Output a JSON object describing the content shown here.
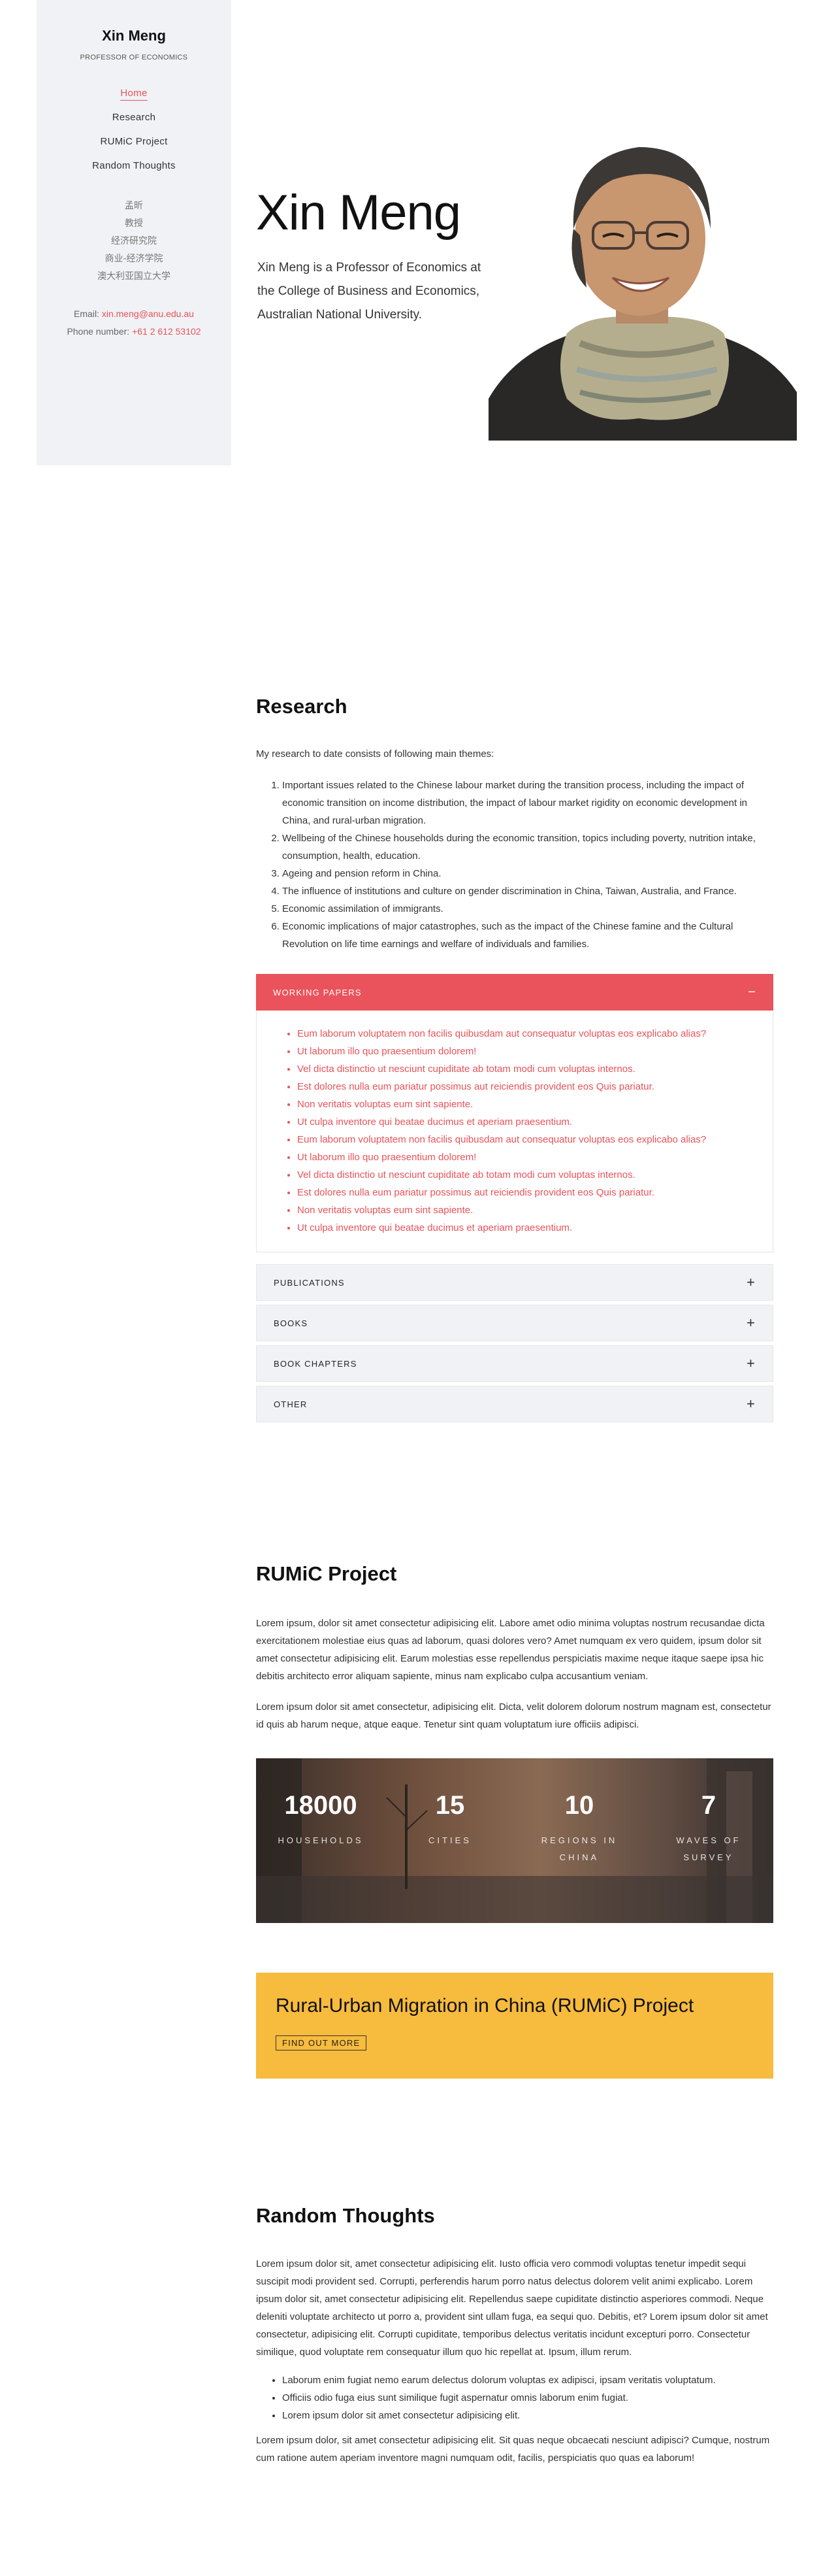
{
  "sidebar": {
    "name": "Xin Meng",
    "role": "PROFESSOR OF ECONOMICS",
    "nav": [
      "Home",
      "Research",
      "RUMiC Project",
      "Random Thoughts"
    ],
    "chinese": [
      "孟昕",
      "教授",
      "经济研究院",
      "商业-经济学院",
      "澳大利亚国立大学"
    ],
    "email_label": "Email: ",
    "email": "xin.meng@anu.edu.au",
    "phone_label": "Phone number: ",
    "phone": "+61 2 612 53102"
  },
  "hero": {
    "title": "Xin Meng",
    "subtitle": "Xin Meng is a Professor of Economics at the College of Business and Economics, Australian National University."
  },
  "research": {
    "heading": "Research",
    "intro": "My research to date consists of following main themes:",
    "themes": [
      "Important issues related to the Chinese labour market during the transition process, including the impact of economic transition on income distribution, the impact of labour market rigidity on economic development in China, and rural-urban migration.",
      "Wellbeing of the Chinese households during the economic transition, topics including poverty, nutrition intake, consumption, health, education.",
      "Ageing and pension reform in China.",
      "The influence of institutions and culture on gender discrimination in China, Taiwan, Australia, and France.",
      "Economic assimilation of immigrants.",
      "Economic implications of major catastrophes, such as the impact of the Chinese famine and the Cultural Revolution on life time earnings and welfare of individuals and families."
    ],
    "accordion": {
      "open_label": "WORKING PAPERS",
      "open_icon": "minus-icon",
      "papers": [
        "Eum laborum voluptatem non facilis quibusdam aut consequatur voluptas eos explicabo alias?",
        "Ut laborum illo quo praesentium dolorem!",
        "Vel dicta distinctio ut nesciunt cupiditate ab totam modi cum voluptas internos.",
        "Est dolores nulla eum pariatur possimus aut reiciendis provident eos Quis pariatur.",
        "Non veritatis voluptas eum sint sapiente.",
        "Ut culpa inventore qui beatae ducimus et aperiam praesentium.",
        "Eum laborum voluptatem non facilis quibusdam aut consequatur voluptas eos explicabo alias?",
        "Ut laborum illo quo praesentium dolorem!",
        "Vel dicta distinctio ut nesciunt cupiditate ab totam modi cum voluptas internos.",
        "Est dolores nulla eum pariatur possimus aut reiciendis provident eos Quis pariatur.",
        "Non veritatis voluptas eum sint sapiente.",
        "Ut culpa inventore qui beatae ducimus et aperiam praesentium."
      ],
      "closed": [
        "PUBLICATIONS",
        "BOOKS",
        "BOOK CHAPTERS",
        "OTHER"
      ],
      "closed_icon": "plus-icon"
    }
  },
  "rumic": {
    "heading": "RUMiC Project",
    "para1": "Lorem ipsum, dolor sit amet consectetur adipisicing elit. Labore amet odio minima voluptas nostrum recusandae dicta exercitationem molestiae eius quas ad laborum, quasi dolores vero? Amet numquam ex vero quidem, ipsum dolor sit amet consectetur adipisicing elit. Earum molestias esse repellendus perspiciatis maxime neque itaque saepe ipsa hic debitis architecto error aliquam sapiente, minus nam explicabo culpa accusantium veniam.",
    "para2": "Lorem ipsum dolor sit amet consectetur, adipisicing elit. Dicta, velit dolorem dolorum nostrum magnam est, consectetur id quis ab harum neque, atque eaque. Tenetur sint quam voluptatum iure officiis adipisci.",
    "stats": [
      {
        "num": "18000",
        "label": "HOUSEHOLDS"
      },
      {
        "num": "15",
        "label": "CITIES"
      },
      {
        "num": "10",
        "label": "REGIONS IN CHINA"
      },
      {
        "num": "7",
        "label": "WAVES OF SURVEY"
      }
    ],
    "cta_title": "Rural-Urban Migration in China (RUMiC) Project",
    "cta_button": "FIND OUT MORE"
  },
  "thoughts": {
    "heading": "Random Thoughts",
    "para1": "Lorem ipsum dolor sit, amet consectetur adipisicing elit. Iusto officia vero commodi voluptas tenetur impedit sequi suscipit modi provident sed. Corrupti, perferendis harum porro natus delectus dolorem velit animi explicabo. Lorem ipsum dolor sit, amet consectetur adipisicing elit. Repellendus saepe cupiditate distinctio asperiores commodi. Neque deleniti voluptate architecto ut porro a, provident sint ullam fuga, ea sequi quo. Debitis, et? Lorem ipsum dolor sit amet consectetur, adipisicing elit. Corrupti cupiditate, temporibus delectus veritatis incidunt excepturi porro. Consectetur similique, quod voluptate rem consequatur illum quo hic repellat at. Ipsum, illum rerum.",
    "bullets": [
      "Laborum enim fugiat nemo earum delectus dolorum voluptas ex adipisci, ipsam veritatis voluptatum.",
      "Officiis odio fuga eius sunt similique fugit aspernatur omnis laborum enim fugiat.",
      "Lorem ipsum dolor sit amet consectetur adipisicing elit."
    ],
    "para2": "Lorem ipsum dolor, sit amet consectetur adipisicing elit. Sit quas neque obcaecati nesciunt adipisci? Cumque, nostrum cum ratione autem aperiam inventore magni numquam odit, facilis, perspiciatis quo quas ea laborum!"
  }
}
